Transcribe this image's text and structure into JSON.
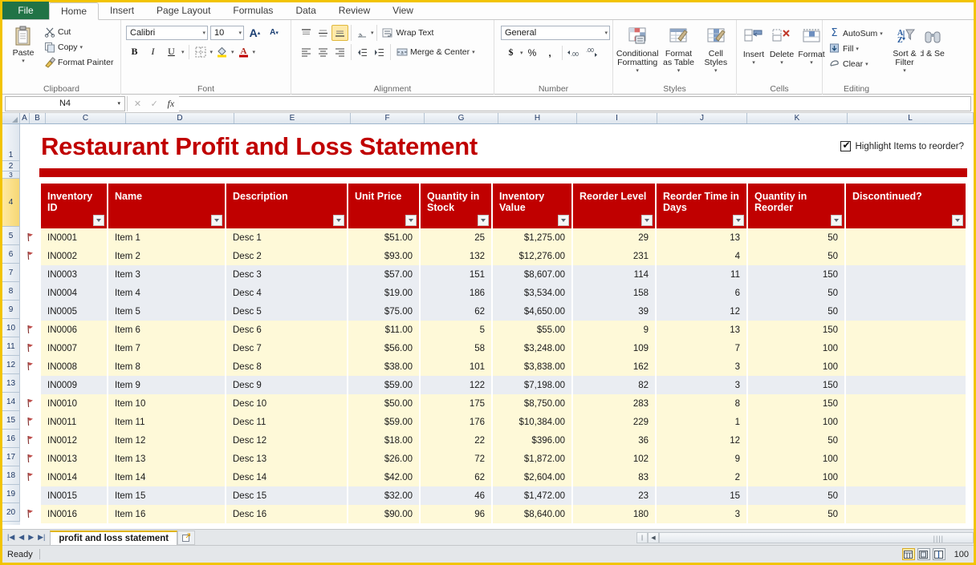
{
  "app": {
    "ribbon_tabs": [
      {
        "label": "File",
        "active": false,
        "type": "file"
      },
      {
        "label": "Home",
        "active": true,
        "type": "normal"
      },
      {
        "label": "Insert",
        "active": false,
        "type": "normal"
      },
      {
        "label": "Page Layout",
        "active": false,
        "type": "normal"
      },
      {
        "label": "Formulas",
        "active": false,
        "type": "normal"
      },
      {
        "label": "Data",
        "active": false,
        "type": "normal"
      },
      {
        "label": "Review",
        "active": false,
        "type": "normal"
      },
      {
        "label": "View",
        "active": false,
        "type": "normal"
      }
    ],
    "groups": {
      "clipboard": {
        "label": "Clipboard",
        "paste": "Paste",
        "cut": "Cut",
        "copy": "Copy",
        "format_painter": "Format Painter"
      },
      "font": {
        "label": "Font",
        "font_name": "Calibri",
        "font_size": "10",
        "grow_font": "A",
        "shrink_font": "A",
        "bold": "B",
        "italic": "I",
        "underline": "U"
      },
      "alignment": {
        "label": "Alignment",
        "wrap_text": "Wrap Text",
        "merge_center": "Merge & Center"
      },
      "number": {
        "label": "Number",
        "format": "General",
        "currency": "$",
        "percent": "%",
        "comma": ",",
        "increase_decimal": ".00",
        "decrease_decimal": ".00"
      },
      "styles": {
        "label": "Styles",
        "conditional_formatting": "Conditional Formatting",
        "format_as_table": "Format as Table",
        "cell_styles": "Cell Styles"
      },
      "cells": {
        "label": "Cells",
        "insert": "Insert",
        "delete": "Delete",
        "format": "Format"
      },
      "editing": {
        "label": "Editing",
        "autosum": "AutoSum",
        "fill": "Fill",
        "clear": "Clear",
        "sort_filter": "Sort & Filter",
        "find_select": "Find & Select"
      }
    },
    "formula_bar": {
      "name_box": "N4",
      "formula_value": "",
      "fx_label": "fx"
    },
    "column_headers": [
      "A",
      "B",
      "C",
      "D",
      "E",
      "F",
      "G",
      "H",
      "I",
      "J",
      "K",
      "L"
    ],
    "row_headers": [
      "1",
      "2",
      "3",
      "4",
      "5",
      "6",
      "7",
      "8",
      "9",
      "10",
      "11",
      "12",
      "13",
      "14",
      "15",
      "16",
      "17",
      "18",
      "19",
      "20"
    ],
    "selected_row": "4",
    "sheet_tabs": [
      {
        "label": "profit and loss statement",
        "active": true
      }
    ],
    "status_text": "Ready",
    "zoom_level": "100",
    "view_buttons": [
      "normal-view",
      "page-layout-view",
      "page-break-view"
    ]
  },
  "sheet": {
    "title": "Restaurant Profit and Loss Statement",
    "highlight_checkbox": {
      "label": "Highlight Items to reorder?",
      "checked": true
    },
    "columns": [
      "Inventory ID",
      "Name",
      "Description",
      "Unit Price",
      "Quantity in Stock",
      "Inventory Value",
      "Reorder Level",
      "Reorder Time in Days",
      "Quantity in Reorder",
      "Discontinued?"
    ],
    "rows": [
      {
        "row": "5",
        "flag": true,
        "shade": "yellow",
        "id": "IN0001",
        "name": "Item 1",
        "desc": "Desc 1",
        "unit_price": "$51.00",
        "qty_stock": "25",
        "inv_value": "$1,275.00",
        "reorder_level": "29",
        "reorder_days": "13",
        "qty_reorder": "50",
        "discontinued": ""
      },
      {
        "row": "6",
        "flag": true,
        "shade": "yellow",
        "id": "IN0002",
        "name": "Item 2",
        "desc": "Desc 2",
        "unit_price": "$93.00",
        "qty_stock": "132",
        "inv_value": "$12,276.00",
        "reorder_level": "231",
        "reorder_days": "4",
        "qty_reorder": "50",
        "discontinued": ""
      },
      {
        "row": "7",
        "flag": false,
        "shade": "gray",
        "id": "IN0003",
        "name": "Item 3",
        "desc": "Desc 3",
        "unit_price": "$57.00",
        "qty_stock": "151",
        "inv_value": "$8,607.00",
        "reorder_level": "114",
        "reorder_days": "11",
        "qty_reorder": "150",
        "discontinued": ""
      },
      {
        "row": "8",
        "flag": false,
        "shade": "gray",
        "id": "IN0004",
        "name": "Item 4",
        "desc": "Desc 4",
        "unit_price": "$19.00",
        "qty_stock": "186",
        "inv_value": "$3,534.00",
        "reorder_level": "158",
        "reorder_days": "6",
        "qty_reorder": "50",
        "discontinued": ""
      },
      {
        "row": "9",
        "flag": false,
        "shade": "gray",
        "id": "IN0005",
        "name": "Item 5",
        "desc": "Desc 5",
        "unit_price": "$75.00",
        "qty_stock": "62",
        "inv_value": "$4,650.00",
        "reorder_level": "39",
        "reorder_days": "12",
        "qty_reorder": "50",
        "discontinued": ""
      },
      {
        "row": "10",
        "flag": true,
        "shade": "yellow",
        "id": "IN0006",
        "name": "Item 6",
        "desc": "Desc 6",
        "unit_price": "$11.00",
        "qty_stock": "5",
        "inv_value": "$55.00",
        "reorder_level": "9",
        "reorder_days": "13",
        "qty_reorder": "150",
        "discontinued": ""
      },
      {
        "row": "11",
        "flag": true,
        "shade": "yellow",
        "id": "IN0007",
        "name": "Item 7",
        "desc": "Desc 7",
        "unit_price": "$56.00",
        "qty_stock": "58",
        "inv_value": "$3,248.00",
        "reorder_level": "109",
        "reorder_days": "7",
        "qty_reorder": "100",
        "discontinued": ""
      },
      {
        "row": "12",
        "flag": true,
        "shade": "yellow",
        "id": "IN0008",
        "name": "Item 8",
        "desc": "Desc 8",
        "unit_price": "$38.00",
        "qty_stock": "101",
        "inv_value": "$3,838.00",
        "reorder_level": "162",
        "reorder_days": "3",
        "qty_reorder": "100",
        "discontinued": ""
      },
      {
        "row": "13",
        "flag": false,
        "shade": "gray",
        "id": "IN0009",
        "name": "Item 9",
        "desc": "Desc 9",
        "unit_price": "$59.00",
        "qty_stock": "122",
        "inv_value": "$7,198.00",
        "reorder_level": "82",
        "reorder_days": "3",
        "qty_reorder": "150",
        "discontinued": ""
      },
      {
        "row": "14",
        "flag": true,
        "shade": "yellow",
        "id": "IN0010",
        "name": "Item 10",
        "desc": "Desc 10",
        "unit_price": "$50.00",
        "qty_stock": "175",
        "inv_value": "$8,750.00",
        "reorder_level": "283",
        "reorder_days": "8",
        "qty_reorder": "150",
        "discontinued": ""
      },
      {
        "row": "15",
        "flag": true,
        "shade": "yellow",
        "id": "IN0011",
        "name": "Item 11",
        "desc": "Desc 11",
        "unit_price": "$59.00",
        "qty_stock": "176",
        "inv_value": "$10,384.00",
        "reorder_level": "229",
        "reorder_days": "1",
        "qty_reorder": "100",
        "discontinued": ""
      },
      {
        "row": "16",
        "flag": true,
        "shade": "yellow",
        "id": "IN0012",
        "name": "Item 12",
        "desc": "Desc 12",
        "unit_price": "$18.00",
        "qty_stock": "22",
        "inv_value": "$396.00",
        "reorder_level": "36",
        "reorder_days": "12",
        "qty_reorder": "50",
        "discontinued": ""
      },
      {
        "row": "17",
        "flag": true,
        "shade": "yellow",
        "id": "IN0013",
        "name": "Item 13",
        "desc": "Desc 13",
        "unit_price": "$26.00",
        "qty_stock": "72",
        "inv_value": "$1,872.00",
        "reorder_level": "102",
        "reorder_days": "9",
        "qty_reorder": "100",
        "discontinued": ""
      },
      {
        "row": "18",
        "flag": true,
        "shade": "yellow",
        "id": "IN0014",
        "name": "Item 14",
        "desc": "Desc 14",
        "unit_price": "$42.00",
        "qty_stock": "62",
        "inv_value": "$2,604.00",
        "reorder_level": "83",
        "reorder_days": "2",
        "qty_reorder": "100",
        "discontinued": ""
      },
      {
        "row": "19",
        "flag": false,
        "shade": "gray",
        "id": "IN0015",
        "name": "Item 15",
        "desc": "Desc 15",
        "unit_price": "$32.00",
        "qty_stock": "46",
        "inv_value": "$1,472.00",
        "reorder_level": "23",
        "reorder_days": "15",
        "qty_reorder": "50",
        "discontinued": ""
      },
      {
        "row": "20",
        "flag": true,
        "shade": "yellow",
        "id": "IN0016",
        "name": "Item 16",
        "desc": "Desc 16",
        "unit_price": "$90.00",
        "qty_stock": "96",
        "inv_value": "$8,640.00",
        "reorder_level": "180",
        "reorder_days": "3",
        "qty_reorder": "50",
        "discontinued": ""
      }
    ]
  },
  "colors": {
    "accent_red": "#C00000",
    "highlight_yellow": "#FEF9D8",
    "row_gray": "#EAEDF2",
    "window_border": "#F2C400",
    "file_green": "#217346"
  }
}
